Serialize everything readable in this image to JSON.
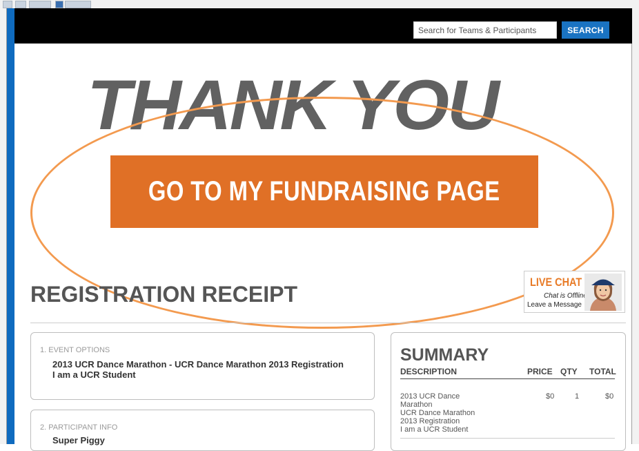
{
  "header": {
    "search": {
      "placeholder": "Search for Teams & Participants",
      "button_label": "SEARCH"
    }
  },
  "hero": {
    "title": "THANK YOU",
    "cta_label": "GO TO MY FUNDRAISING PAGE"
  },
  "live_chat": {
    "title": "LIVE CHAT",
    "status": "Chat is Offline",
    "message": "Leave a Message"
  },
  "receipt": {
    "title": "REGISTRATION RECEIPT",
    "event_options": {
      "label": "1. EVENT OPTIONS",
      "line1": "2013 UCR Dance Marathon - UCR Dance Marathon 2013 Registration",
      "line2": "I am a UCR Student"
    },
    "participant_info": {
      "label": "2. PARTICIPANT INFO",
      "name": "Super Piggy"
    }
  },
  "summary": {
    "title": "SUMMARY",
    "columns": {
      "description": "DESCRIPTION",
      "price": "PRICE",
      "qty": "QTY",
      "total": "TOTAL"
    },
    "row": {
      "description_lines": [
        "2013 UCR Dance",
        "Marathon",
        "UCR Dance Marathon",
        "2013 Registration",
        "I am a UCR Student"
      ],
      "price": "$0",
      "qty": "1",
      "total": "$0"
    }
  },
  "colors": {
    "accent_orange": "#e07026",
    "brand_blue": "#1a73c2",
    "annotation_oval": "#f39a4f"
  },
  "icons": {
    "chat_avatar": "agent-avatar-icon"
  }
}
